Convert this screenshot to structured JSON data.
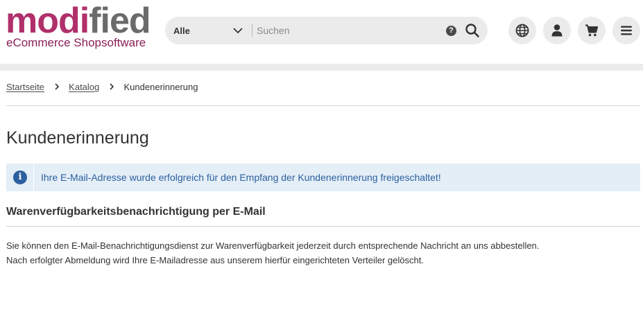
{
  "header": {
    "logo": {
      "pink": "modi",
      "gray": "fied",
      "tagline": "eCommerce Shopsoftware"
    },
    "search": {
      "category": "Alle",
      "placeholder": "Suchen",
      "help_glyph": "?"
    },
    "icons": [
      "globe-icon",
      "user-icon",
      "cart-icon",
      "menu-icon"
    ]
  },
  "breadcrumb": {
    "items": [
      "Startseite",
      "Katalog"
    ],
    "current": "Kundenerinnerung"
  },
  "page": {
    "title": "Kundenerinnerung",
    "alert": {
      "icon_glyph": "i",
      "text": "Ihre E-Mail-Adresse wurde erfolgreich für den Empfang der Kundenerinnerung freigeschaltet!"
    },
    "section_title": "Warenverfügbarkeitsbenachrichtigung per E-Mail",
    "body_lines": [
      "Sie können den E-Mail-Benachrichtigungsdienst zur Warenverfügbarkeit jederzeit durch entsprechende Nachricht an uns abbestellen.",
      "Nach erfolgter Abmeldung wird Ihre E-Mailadresse aus unserem hierfür eingerichteten Verteiler gelöscht."
    ]
  },
  "colors": {
    "brand_pink": "#b0306b",
    "brand_gray": "#6b6b6b",
    "info_blue": "#2c5f9e",
    "info_bg": "#e4eef7",
    "button_bg": "#ebebeb"
  }
}
